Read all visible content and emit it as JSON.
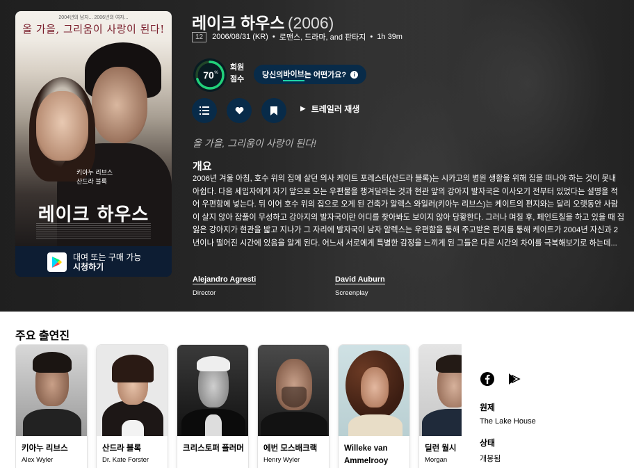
{
  "movie": {
    "title": "레이크 하우스",
    "year": "(2006)",
    "certification": "12",
    "release": "2006/08/31 (KR)",
    "genres": "로맨스, 드라마, and 판타지",
    "runtime": "1h 39m",
    "score": "70",
    "score_unit": "%",
    "score_fraction": 0.7,
    "score_label_1": "회원",
    "score_label_2": "점수",
    "vibe_prefix": "당신의 ",
    "vibe_highlight": "바이브",
    "vibe_suffix": "는 어떤가요?",
    "trailer_label": "트레일러 재생",
    "tagline": "올 가을, 그리움이 사랑이 된다!",
    "overview_heading": "개요",
    "overview": "2006년 겨울 아침, 호수 위의 집에 살던 의사 케이트 포레스터(산드라 블록)는 시카고의 병원 생활을 위해 집을 떠나야 하는 것이 못내 아쉽다. 다음 세입자에게 자기 앞으로 오는 우편물을 챙겨달라는 것과 현관 앞의 강아지 발자국은 이사오기 전부터 있었다는 설명을 적어 우편함에 넣는다. 뒤 이어 호수 위의 집으로 오게 된 건축가 알렉스 와일러(키아누 리브스)는 케이트의 편지와는 달리 오랫동안 사람이 살지 않아 잡풀이 무성하고 강아지의 발자국이란 어디를 찾아봐도 보이지 않아 당황한다. 그러나 며칠 후, 페인트칠을 하고 있을 때 집 잃은 강아지가 현관을 밟고 지나가 그 자리에 발자국이 남자 알렉스는 우편함을 통해 주고받은 편지를 통해 케이트가 2004년 자신과 2년이나 떨어진 시간에 있음을 알게 된다. 어느새 서로에게 특별한 감정을 느끼게 된 그들은 다른 시간의 차이를 극복해보기로 하는데...",
    "crew": [
      {
        "name": "Alejandro Agresti",
        "job": "Director"
      },
      {
        "name": "David Auburn",
        "job": "Screenplay"
      }
    ]
  },
  "poster": {
    "tagline_small": "2004년의 남자... 2006년의 여자...",
    "tagline": "올 가을, 그리움이 사랑이 된다!",
    "cast_line_1": "키아누 리브스",
    "cast_line_2": "산드라 블록",
    "title": "레이크 하우스"
  },
  "watch": {
    "line1": "대여 또는 구매 가능",
    "line2": "시청하기"
  },
  "cast_heading": "주요 출연진",
  "cast": [
    {
      "name": "키아누 리브스",
      "character": "Alex Wyler"
    },
    {
      "name": "산드라 블록",
      "character": "Dr. Kate Forster"
    },
    {
      "name": "크리스토퍼 플러머",
      "character": ""
    },
    {
      "name": "에번 모스배크랙",
      "character": "Henry Wyler"
    },
    {
      "name": "Willeke van Ammelrooy",
      "character": ""
    },
    {
      "name": "딜런 월시",
      "character": "Morgan"
    }
  ],
  "sidebar": {
    "original_title_label": "원제",
    "original_title": "The Lake House",
    "status_label": "상태",
    "status": "개봉됨"
  },
  "icons": [
    "list-icon",
    "heart-icon",
    "bookmark-icon",
    "play-icon",
    "info-icon",
    "facebook-icon",
    "justwatch-icon",
    "google-play-icon"
  ],
  "colors": {
    "accent": "#1ed5a9",
    "navy": "#082b49",
    "poster_bar": "#0d1d33"
  }
}
